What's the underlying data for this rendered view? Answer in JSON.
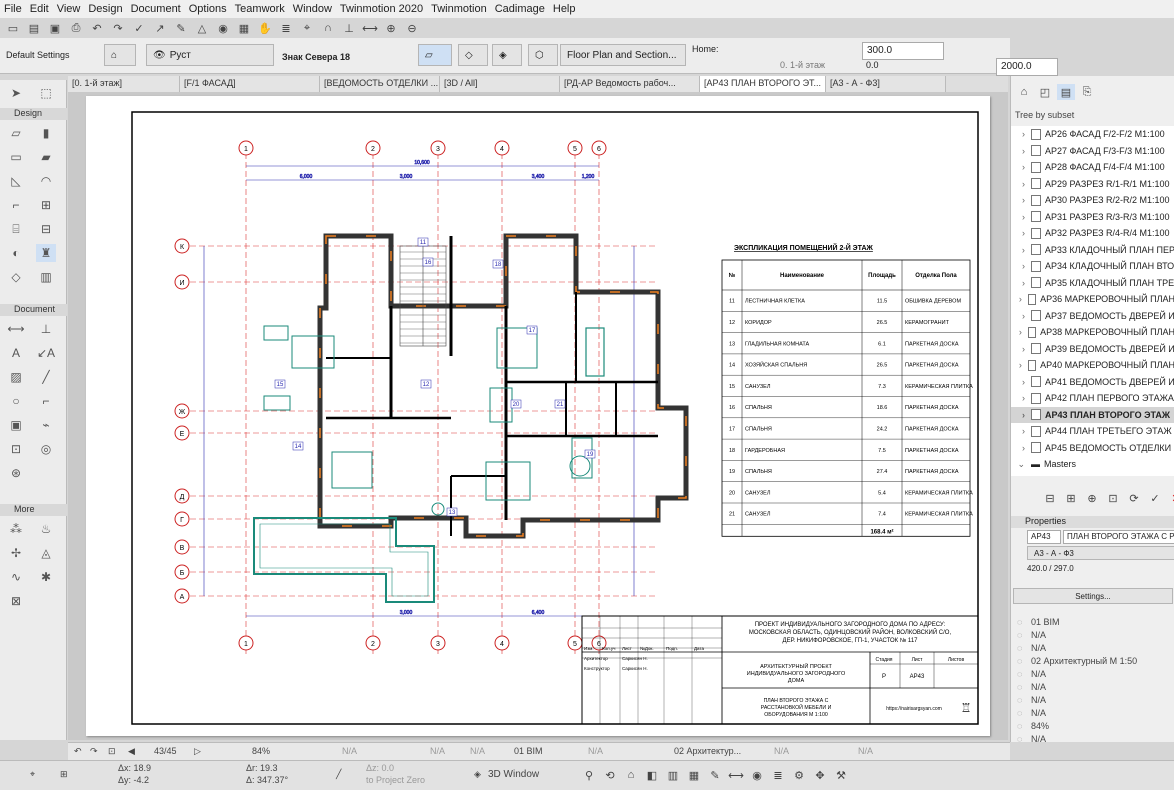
{
  "menu": [
    "File",
    "Edit",
    "View",
    "Design",
    "Document",
    "Options",
    "Teamwork",
    "Window",
    "Twinmotion 2020",
    "Twinmotion",
    "Cadimage",
    "Help"
  ],
  "infobox": {
    "settings": "Default Settings",
    "layer": "Руст",
    "story": "Знак Севера 18",
    "view_mode": "Floor Plan and Section...",
    "home_label": "Home:",
    "home_story": "0. 1-й этаж",
    "val1": "300.0",
    "val2": "0.0",
    "val3": "2000.0"
  },
  "tabs": [
    {
      "label": "[0. 1-й этаж]"
    },
    {
      "label": "[F/1 ФАСАД]"
    },
    {
      "label": "[ВЕДОМОСТЬ ОТДЕЛКИ ..."
    },
    {
      "label": "[3D / All]"
    },
    {
      "label": "[РД-АР Ведомость рабоч..."
    },
    {
      "label": "[АР43 ПЛАН ВТОРОГО ЭТ..."
    },
    {
      "label": "[А3 - А - Ф3]"
    }
  ],
  "toolbox": {
    "design": "Design",
    "document": "Document",
    "more": "More"
  },
  "navigator": {
    "tree_label": "Tree by subset",
    "items": [
      "АР26 ФАСАД F/2-F/2 М1:100",
      "АР27 ФАСАД F/3-F/3 М1:100",
      "АР28 ФАСАД F/4-F/4 М1:100",
      "АР29 РАЗРЕЗ R/1-R/1 М1:100",
      "АР30 РАЗРЕЗ R/2-R/2 М1:100",
      "АР31 РАЗРЕЗ R/3-R/3 М1:100",
      "АР32 РАЗРЕЗ R/4-R/4 М1:100",
      "АР33 КЛАДОЧНЫЙ ПЛАН ПЕР",
      "АР34 КЛАДОЧНЫЙ ПЛАН ВТО",
      "АР35 КЛАДОЧНЫЙ ПЛАН ТРЕ",
      "АР36 МАРКЕРОВОЧНЫЙ ПЛАН",
      "АР37 ВЕДОМОСТЬ ДВЕРЕЙ И",
      "АР38 МАРКЕРОВОЧНЫЙ ПЛАН",
      "АР39 ВЕДОМОСТЬ ДВЕРЕЙ И",
      "АР40 МАРКЕРОВОЧНЫЙ ПЛАН",
      "АР41 ВЕДОМОСТЬ ДВЕРЕЙ И",
      "АР42 ПЛАН ПЕРВОГО ЭТАЖА",
      "АР43 ПЛАН ВТОРОГО ЭТАЖ",
      "АР44 ПЛАН ТРЕТЬЕГО ЭТАЖ",
      "АР45 ВЕДОМОСТЬ ОТДЕЛКИ"
    ],
    "selected_index": 17,
    "masters": "Masters"
  },
  "properties": {
    "header": "Properties",
    "id": "АР43",
    "name": "ПЛАН ВТОРОГО ЭТАЖА С РАС",
    "layout": "А3 - А - Ф3",
    "size": "420.0 / 297.0",
    "settings_btn": "Settings...",
    "rows": [
      "01 BIM",
      "N/A",
      "N/A",
      "02 Архитектурный М 1:50",
      "N/A",
      "N/A",
      "N/A",
      "N/A",
      "84%",
      "N/A"
    ]
  },
  "status": {
    "page": "43/45",
    "zoom": "84%",
    "na1": "N/A",
    "na2": "N/A",
    "na3": "N/A",
    "bim": "01 BIM",
    "na4": "N/A",
    "arch": "02 Архитектур...",
    "na5": "N/A",
    "na6": "N/A"
  },
  "coords": {
    "dx": "Δx: 18.9",
    "dy": "Δy: -4.2",
    "dr": "Δr: 19.3",
    "da": "Δ: 347.37°",
    "dz": "Δz: 0.0",
    "proj": "to Project Zero",
    "window3d": "3D Window"
  },
  "drawing": {
    "table_title": "ЭКСПЛИКАЦИЯ ПОМЕЩЕНИЙ 2-Й ЭТАЖ",
    "headers": [
      "№",
      "Наименование",
      "Площадь",
      "Отделка Пола"
    ],
    "rows": [
      [
        "11",
        "ЛЕСТНИЧНАЯ КЛЕТКА",
        "11.5",
        "ОБШИВКА ДЕРЕВОМ"
      ],
      [
        "12",
        "КОРИДОР",
        "26.5",
        "КЕРАМОГРАНИТ"
      ],
      [
        "13",
        "ГЛАДИЛЬНАЯ КОМНАТА",
        "6.1",
        "ПАРКЕТНАЯ ДОСКА"
      ],
      [
        "14",
        "ХОЗЯЙСКАЯ СПАЛЬНЯ",
        "26.5",
        "ПАРКЕТНАЯ ДОСКА"
      ],
      [
        "15",
        "САНУЗЕЛ",
        "7.3",
        "КЕРАМИЧЕСКАЯ ПЛИТКА"
      ],
      [
        "16",
        "СПАЛЬНЯ",
        "18.6",
        "ПАРКЕТНАЯ ДОСКА"
      ],
      [
        "17",
        "СПАЛЬНЯ",
        "24.2",
        "ПАРКЕТНАЯ ДОСКА"
      ],
      [
        "18",
        "ГАРДЕРОБНАЯ",
        "7.5",
        "ПАРКЕТНАЯ ДОСКА"
      ],
      [
        "19",
        "СПАЛЬНЯ",
        "27.4",
        "ПАРКЕТНАЯ ДОСКА"
      ],
      [
        "20",
        "САНУЗЕЛ",
        "5.4",
        "КЕРАМИЧЕСКАЯ ПЛИТКА"
      ],
      [
        "21",
        "САНУЗЕЛ",
        "7.4",
        "КЕРАМИЧЕСКАЯ ПЛИТКА"
      ]
    ],
    "total": "168.4 м²",
    "stamp": {
      "project": "ПРОЕКТ ИНДИВИДУАЛЬНОГО ЗАГОРОДНОГО ДОМА ПО АДРЕСУ: МОСКОВСКАЯ ОБЛАСТЬ, ОДИНЦОВСКИЙ РАЙОН, ВОЛКОВСКИЙ С/О, ДЕР. НИКИФОРОВСКОЕ, ГП-1, УЧАСТОК № 117",
      "arch_project": "АРХИТЕКТУРНЫЙ ПРОЕКТ ИНДИВИДУАЛЬНОГО ЗАГОРОДНОГО ДОМА",
      "sheet_title": "ПЛАН ВТОРОГО ЭТАЖА С РАССТАНОВКОЙ МЕБЕЛИ И ОБОРУДОВАНИЯ М 1:100",
      "stage_h": "Стадия",
      "sheet_h": "Лист",
      "sheets_h": "Листов",
      "stage": "Р",
      "sheet": "АР43",
      "url": "https://nairisargsyan.com",
      "cols": [
        "Изм.",
        "Кол.уч",
        "Лист",
        "№Док.",
        "Подп.",
        "Дата"
      ],
      "role1": "Архитектор",
      "name1": "Саркисян Н.",
      "role2": "Конструктор",
      "name2": "Саркисян Н."
    },
    "axes_top": [
      "1",
      "2",
      "3",
      "4",
      "5",
      "6"
    ],
    "axes_left": [
      "К",
      "И",
      "Ж",
      "Е",
      "Д",
      "Г",
      "В",
      "Б",
      "А"
    ],
    "dims_top": [
      "10,600",
      "6,000",
      "3,000",
      "3,400",
      "1,200"
    ],
    "dims_bottom": [
      "3,000",
      "6,400"
    ],
    "rooms": [
      "11",
      "12",
      "13",
      "14",
      "15",
      "16",
      "17",
      "18",
      "19",
      "20",
      "21"
    ]
  }
}
